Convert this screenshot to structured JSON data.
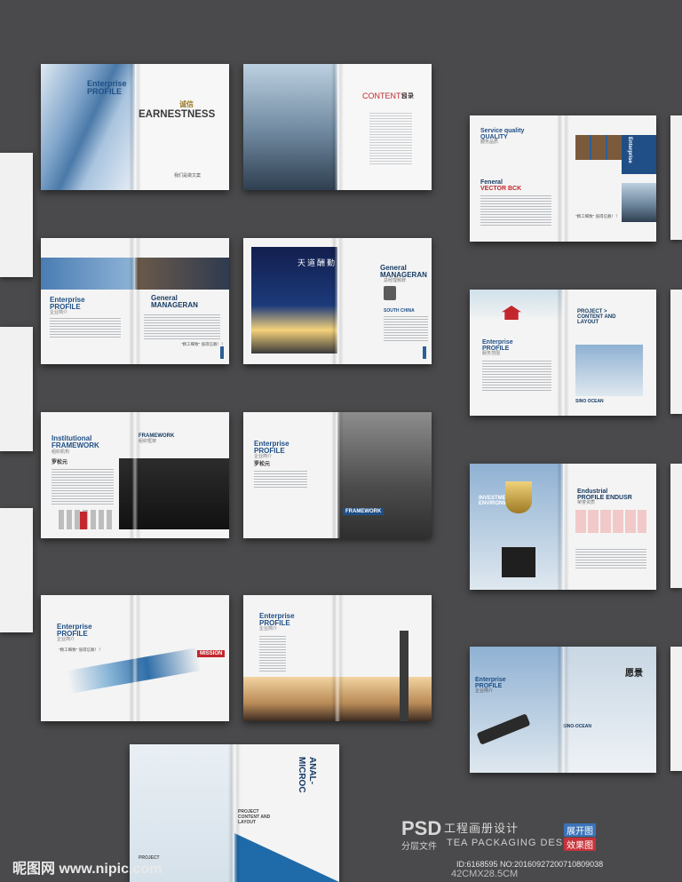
{
  "spreads": {
    "s1": {
      "left_title_1": "Enterprise",
      "left_title_2": "PROFILE",
      "right_cn": "诚信",
      "right_title": "EARNESTNESS",
      "right_small": "我们是做文案"
    },
    "s2": {
      "contents": "CONTENTS",
      "contents_cn": "目录"
    },
    "s3": {
      "left_title_1": "Enterprise",
      "left_title_2": "PROFILE",
      "left_cn": "企业简介",
      "right_title_1": "General",
      "right_title_2": "MANAGERAN",
      "right_cn": "总经理致辞",
      "quote": "\"精工细致\" 值得信赖！！"
    },
    "s4": {
      "right_title_1": "General",
      "right_title_2": "MANAGERAN",
      "right_cn": "总经理致辞",
      "sub": "SOUTH CHINA",
      "poem": "天道酬勤"
    },
    "s5": {
      "left_title_1": "Institutional",
      "left_title_2": "FRAMEWORK",
      "left_cn": "组织机构",
      "left_head": "罗松元",
      "right_title": "FRAMEWORK",
      "right_cn": "组织框架"
    },
    "s6": {
      "left_title_1": "Enterprise",
      "left_title_2": "PROFILE",
      "left_cn": "企业简介",
      "left_head": "罗松元",
      "right_title": "FRAMEWORK"
    },
    "s7": {
      "left_title_1": "Enterprise",
      "left_title_2": "PROFILE",
      "left_cn": "企业简介",
      "quote": "\"精工细致\" 值得信赖！！",
      "right_tag": "MISSION"
    },
    "s8": {
      "left_title_1": "Enterprise",
      "left_title_2": "PROFILE",
      "left_cn": "企业简介"
    },
    "s9": {
      "right_title_1": "ANAL-",
      "right_title_2": "MICROC",
      "left_small_1": "PROJECT",
      "left_small_2": "CONTENT AND",
      "left_small_3": "LAYOUT"
    },
    "s10": {
      "left_title_1": "Service quality",
      "left_title_2": "QUALITY",
      "left_cn": "服务品质",
      "left_title_3": "Feneral",
      "left_title_4": "VECTOR BCK",
      "right_title_1": "Enterprise",
      "right_title_2": "PROFILE",
      "quote": "\"精工细致\" 值得信赖！！"
    },
    "s11": {
      "left_title_1": "Enterprise",
      "left_title_2": "PROFILE",
      "left_cn": "服务范围",
      "right_title_1": "PROJECT >",
      "right_title_2": "CONTENT AND",
      "right_title_3": "LAYOUT",
      "right_small": "SINO OCEAN"
    },
    "s12": {
      "left_title_1": "INVESTMENT",
      "left_title_2": "ENVIRONMENT",
      "right_title_1": "Endustrial",
      "right_title_2": "PROFILE ENDUSR",
      "right_cn": "荣誉资质"
    },
    "s13": {
      "left_title_1": "Enterprise",
      "left_title_2": "PROFILE",
      "left_cn": "企业简介",
      "right_cn": "愿景",
      "right_small": "SINO-OCEAN"
    }
  },
  "watermark": {
    "psd": "PSD",
    "cn_title": "工程画册设计",
    "sub_cn": "分层文件",
    "sub_en": "TEA PACKAGING DESIGN",
    "tag_open": "展开图",
    "tag_effect": "效果图",
    "site": "昵图网 www.nipic.com",
    "id_line": "ID:6168595 NO:20160927200710809038",
    "size_line": "42CMX28.5CM"
  },
  "colors": {
    "background": "#4a4a4c",
    "accent": "#1f4f86",
    "red": "#c2272d"
  }
}
